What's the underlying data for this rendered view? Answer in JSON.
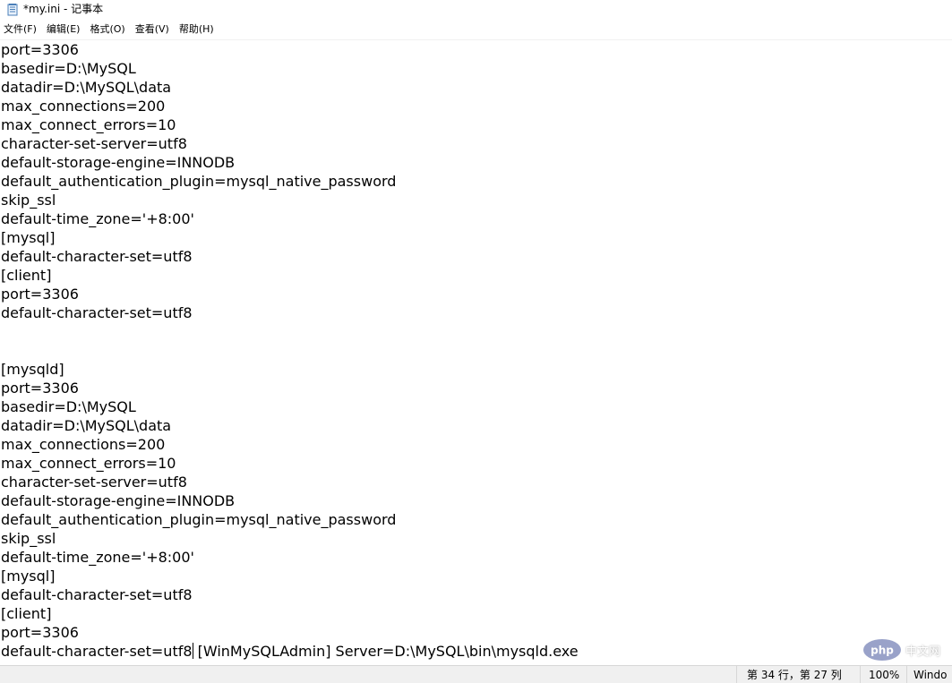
{
  "window": {
    "title": "*my.ini - 记事本"
  },
  "menubar": {
    "items": [
      {
        "label": "文件(F)"
      },
      {
        "label": "编辑(E)"
      },
      {
        "label": "格式(O)"
      },
      {
        "label": "查看(V)"
      },
      {
        "label": "帮助(H)"
      }
    ]
  },
  "editor": {
    "lines": [
      "port=3306",
      "basedir=D:\\MySQL",
      "datadir=D:\\MySQL\\data",
      "max_connections=200",
      "max_connect_errors=10",
      "character-set-server=utf8",
      "default-storage-engine=INNODB",
      "default_authentication_plugin=mysql_native_password",
      "skip_ssl",
      "default-time_zone='+8:00'",
      "[mysql]",
      "default-character-set=utf8",
      "[client]",
      "port=3306",
      "default-character-set=utf8",
      "",
      "",
      "[mysqld]",
      "port=3306",
      "basedir=D:\\MySQL",
      "datadir=D:\\MySQL\\data",
      "max_connections=200",
      "max_connect_errors=10",
      "character-set-server=utf8",
      "default-storage-engine=INNODB",
      "default_authentication_plugin=mysql_native_password",
      "skip_ssl",
      "default-time_zone='+8:00'",
      "[mysql]",
      "default-character-set=utf8",
      "[client]",
      "port=3306"
    ],
    "last_line_before_caret": "default-character-set=utf8",
    "last_line_after_caret": " [WinMySQLAdmin] Server=D:\\MySQL\\bin\\mysqld.exe"
  },
  "statusbar": {
    "position": "第 34 行，第 27 列",
    "zoom": "100%",
    "line_ending": "Windo"
  },
  "watermark": {
    "text": "中文网"
  },
  "colors": {
    "statusbar_bg": "#f0f0f0",
    "text": "#000000",
    "php_badge": "#7a86b8"
  }
}
